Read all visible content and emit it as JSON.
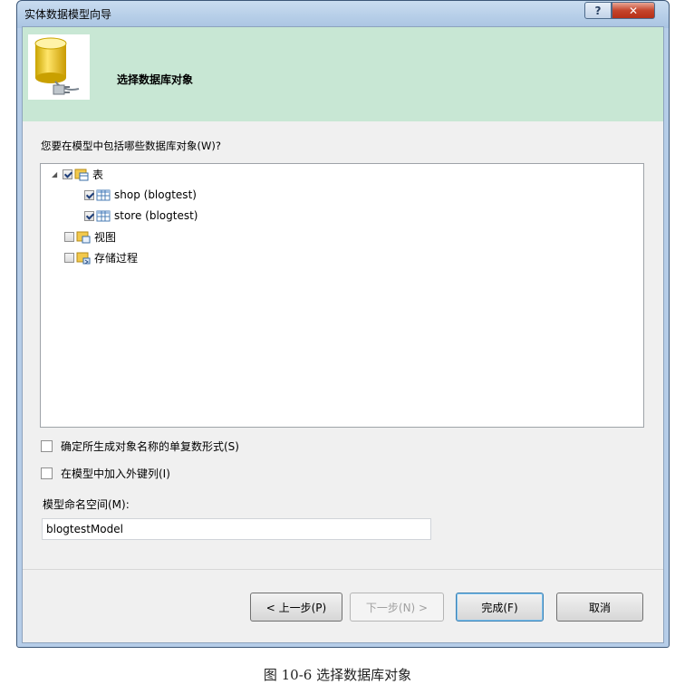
{
  "window": {
    "title": "实体数据模型向导",
    "help_glyph": "?",
    "close_glyph": "✕"
  },
  "header": {
    "title": "选择数据库对象"
  },
  "prompt": "您要在模型中包括哪些数据库对象(W)?",
  "tree": {
    "tables": {
      "label": "表",
      "checked": true,
      "expanded": true,
      "children": [
        {
          "label": "shop (blogtest)",
          "checked": true
        },
        {
          "label": "store (blogtest)",
          "checked": true
        }
      ]
    },
    "views": {
      "label": "视图",
      "checked": false
    },
    "procedures": {
      "label": "存储过程",
      "checked": false
    }
  },
  "options": {
    "pluralize": {
      "label": "确定所生成对象名称的单复数形式(S)",
      "checked": false
    },
    "foreign_keys": {
      "label": "在模型中加入外键列(I)",
      "checked": false
    }
  },
  "namespace": {
    "label": "模型命名空间(M):",
    "value": "blogtestModel"
  },
  "buttons": {
    "previous": "< 上一步(P)",
    "next": "下一步(N) >",
    "finish": "完成(F)",
    "cancel": "取消"
  },
  "caption": "图 10-6 选择数据库对象"
}
